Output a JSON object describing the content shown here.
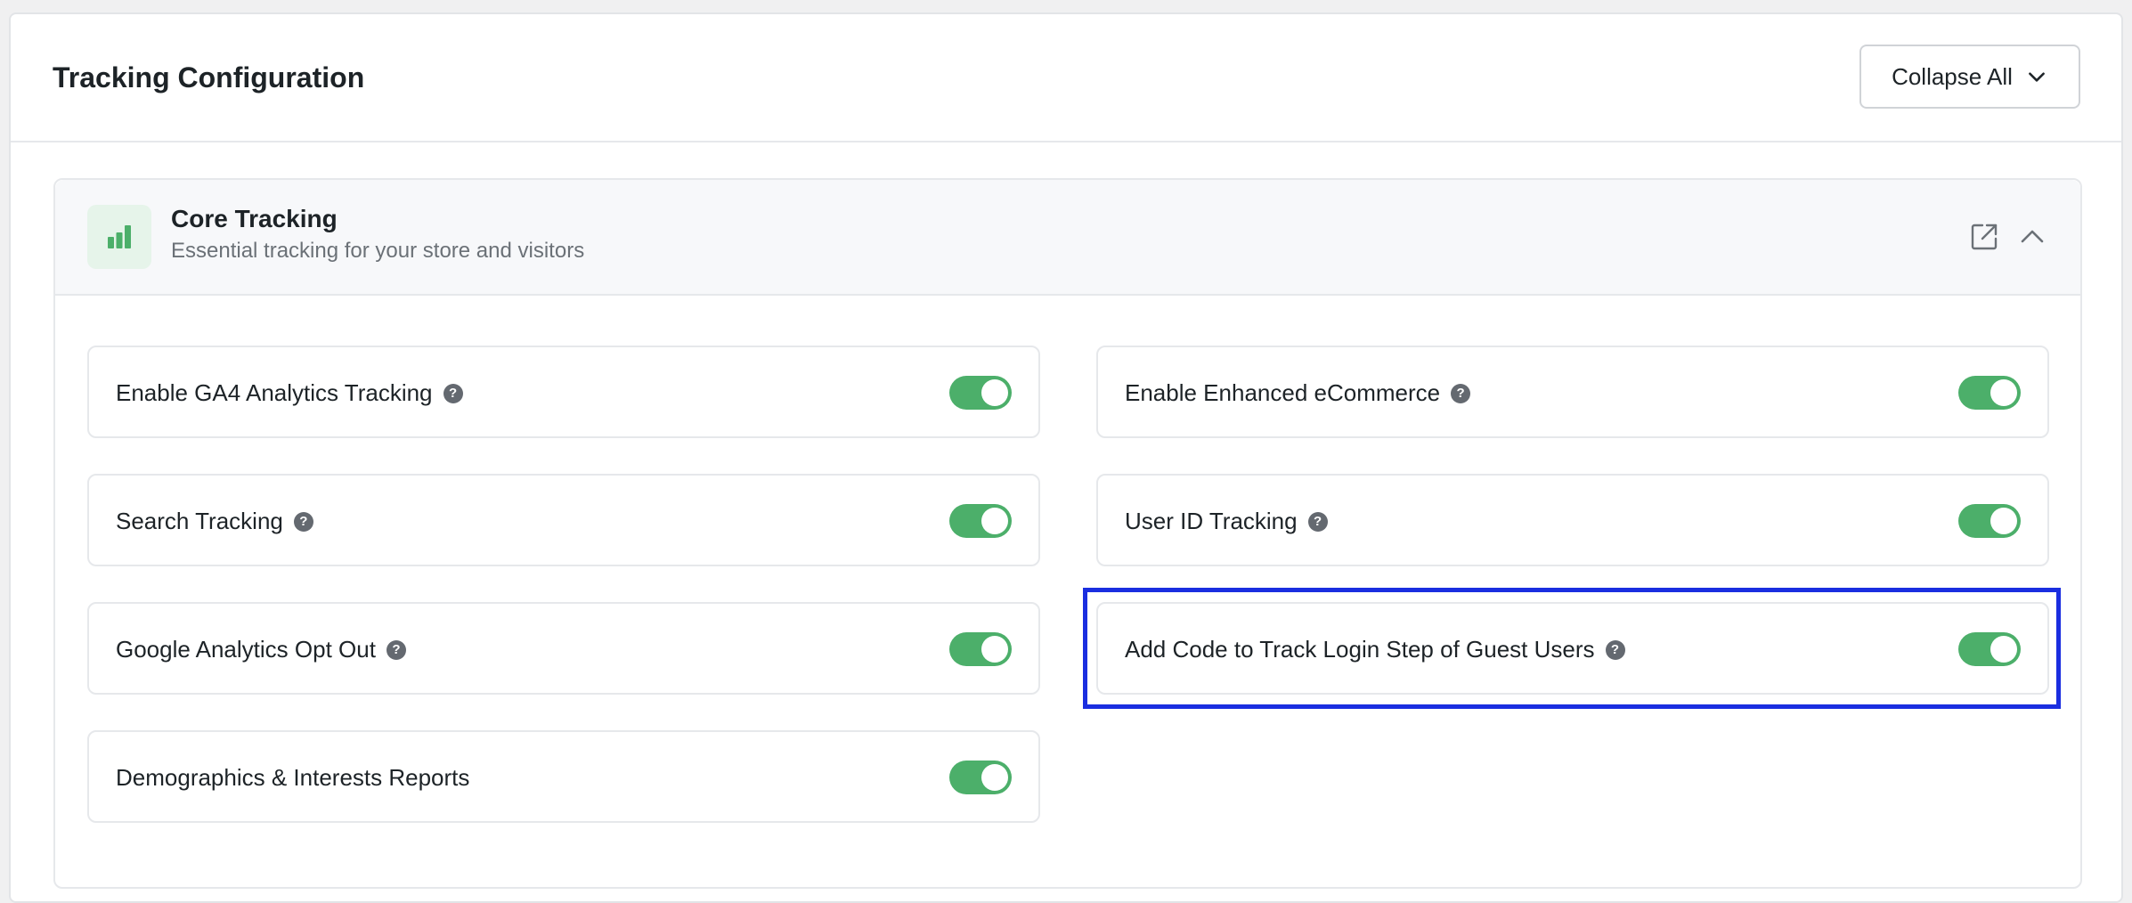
{
  "header": {
    "title": "Tracking Configuration",
    "collapse_label": "Collapse All"
  },
  "section": {
    "title": "Core Tracking",
    "subtitle": "Essential tracking for your store and visitors"
  },
  "settings": [
    {
      "label": "Enable GA4 Analytics Tracking",
      "enabled": true,
      "help": true
    },
    {
      "label": "Enable Enhanced eCommerce",
      "enabled": true,
      "help": true
    },
    {
      "label": "Search Tracking",
      "enabled": true,
      "help": true
    },
    {
      "label": "User ID Tracking",
      "enabled": true,
      "help": true
    },
    {
      "label": "Google Analytics Opt Out",
      "enabled": true,
      "help": true
    },
    {
      "label": "Add Code to Track Login Step of Guest Users",
      "enabled": true,
      "help": true,
      "highlighted": true
    },
    {
      "label": "Demographics & Interests Reports",
      "enabled": true,
      "help": false
    }
  ],
  "help_glyph": "?",
  "colors": {
    "toggle_on": "#4caf6a",
    "accent_icon": "#4caf6a",
    "highlight": "#1a2ee0"
  }
}
